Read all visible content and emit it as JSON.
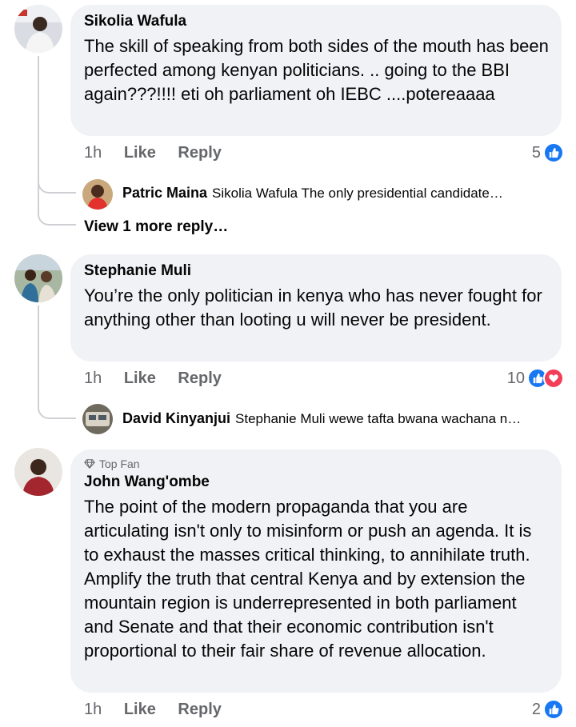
{
  "comments": [
    {
      "author": "Sikolia Wafula",
      "text": "The skill of speaking from both sides of the mouth has been perfected among kenyan politicians. .. going to the BBI again???!!!! eti oh parliament oh IEBC ....potereaaaa",
      "time": "1h",
      "like_label": "Like",
      "reply_label": "Reply",
      "reaction_count": "5",
      "reactions": [
        "like-icon"
      ],
      "replies": [
        {
          "author": "Patric Maina",
          "snippet": "Sikolia Wafula The only presidential candidate…"
        }
      ],
      "more_replies": "View 1 more reply…"
    },
    {
      "author": "Stephanie Muli",
      "text": "You’re the only politician in kenya who has never fought for anything other than looting u will never be president.",
      "time": "1h",
      "like_label": "Like",
      "reply_label": "Reply",
      "reaction_count": "10",
      "reactions": [
        "like-icon",
        "love-icon"
      ],
      "replies": [
        {
          "author": "David Kinyanjui",
          "snippet": "Stephanie Muli wewe tafta bwana wachana n…"
        }
      ]
    },
    {
      "badge": "Top Fan",
      "author": "John Wang'ombe",
      "text": "The point of the modern propaganda that you are articulating isn't only to misinform or push an agenda. It is to exhaust the masses critical thinking, to annihilate truth. Amplify the truth that central Kenya and by extension the mountain region is underrepresented in both parliament and Senate and that their economic contribution isn't proportional to their fair share of revenue allocation.",
      "time": "1h",
      "like_label": "Like",
      "reply_label": "Reply",
      "reaction_count": "2",
      "reactions": [
        "like-icon"
      ]
    }
  ],
  "colors": {
    "bubble": "#f0f2f5",
    "like": "#1877f2",
    "love": "#f33e58",
    "secondary_text": "#65676b"
  }
}
